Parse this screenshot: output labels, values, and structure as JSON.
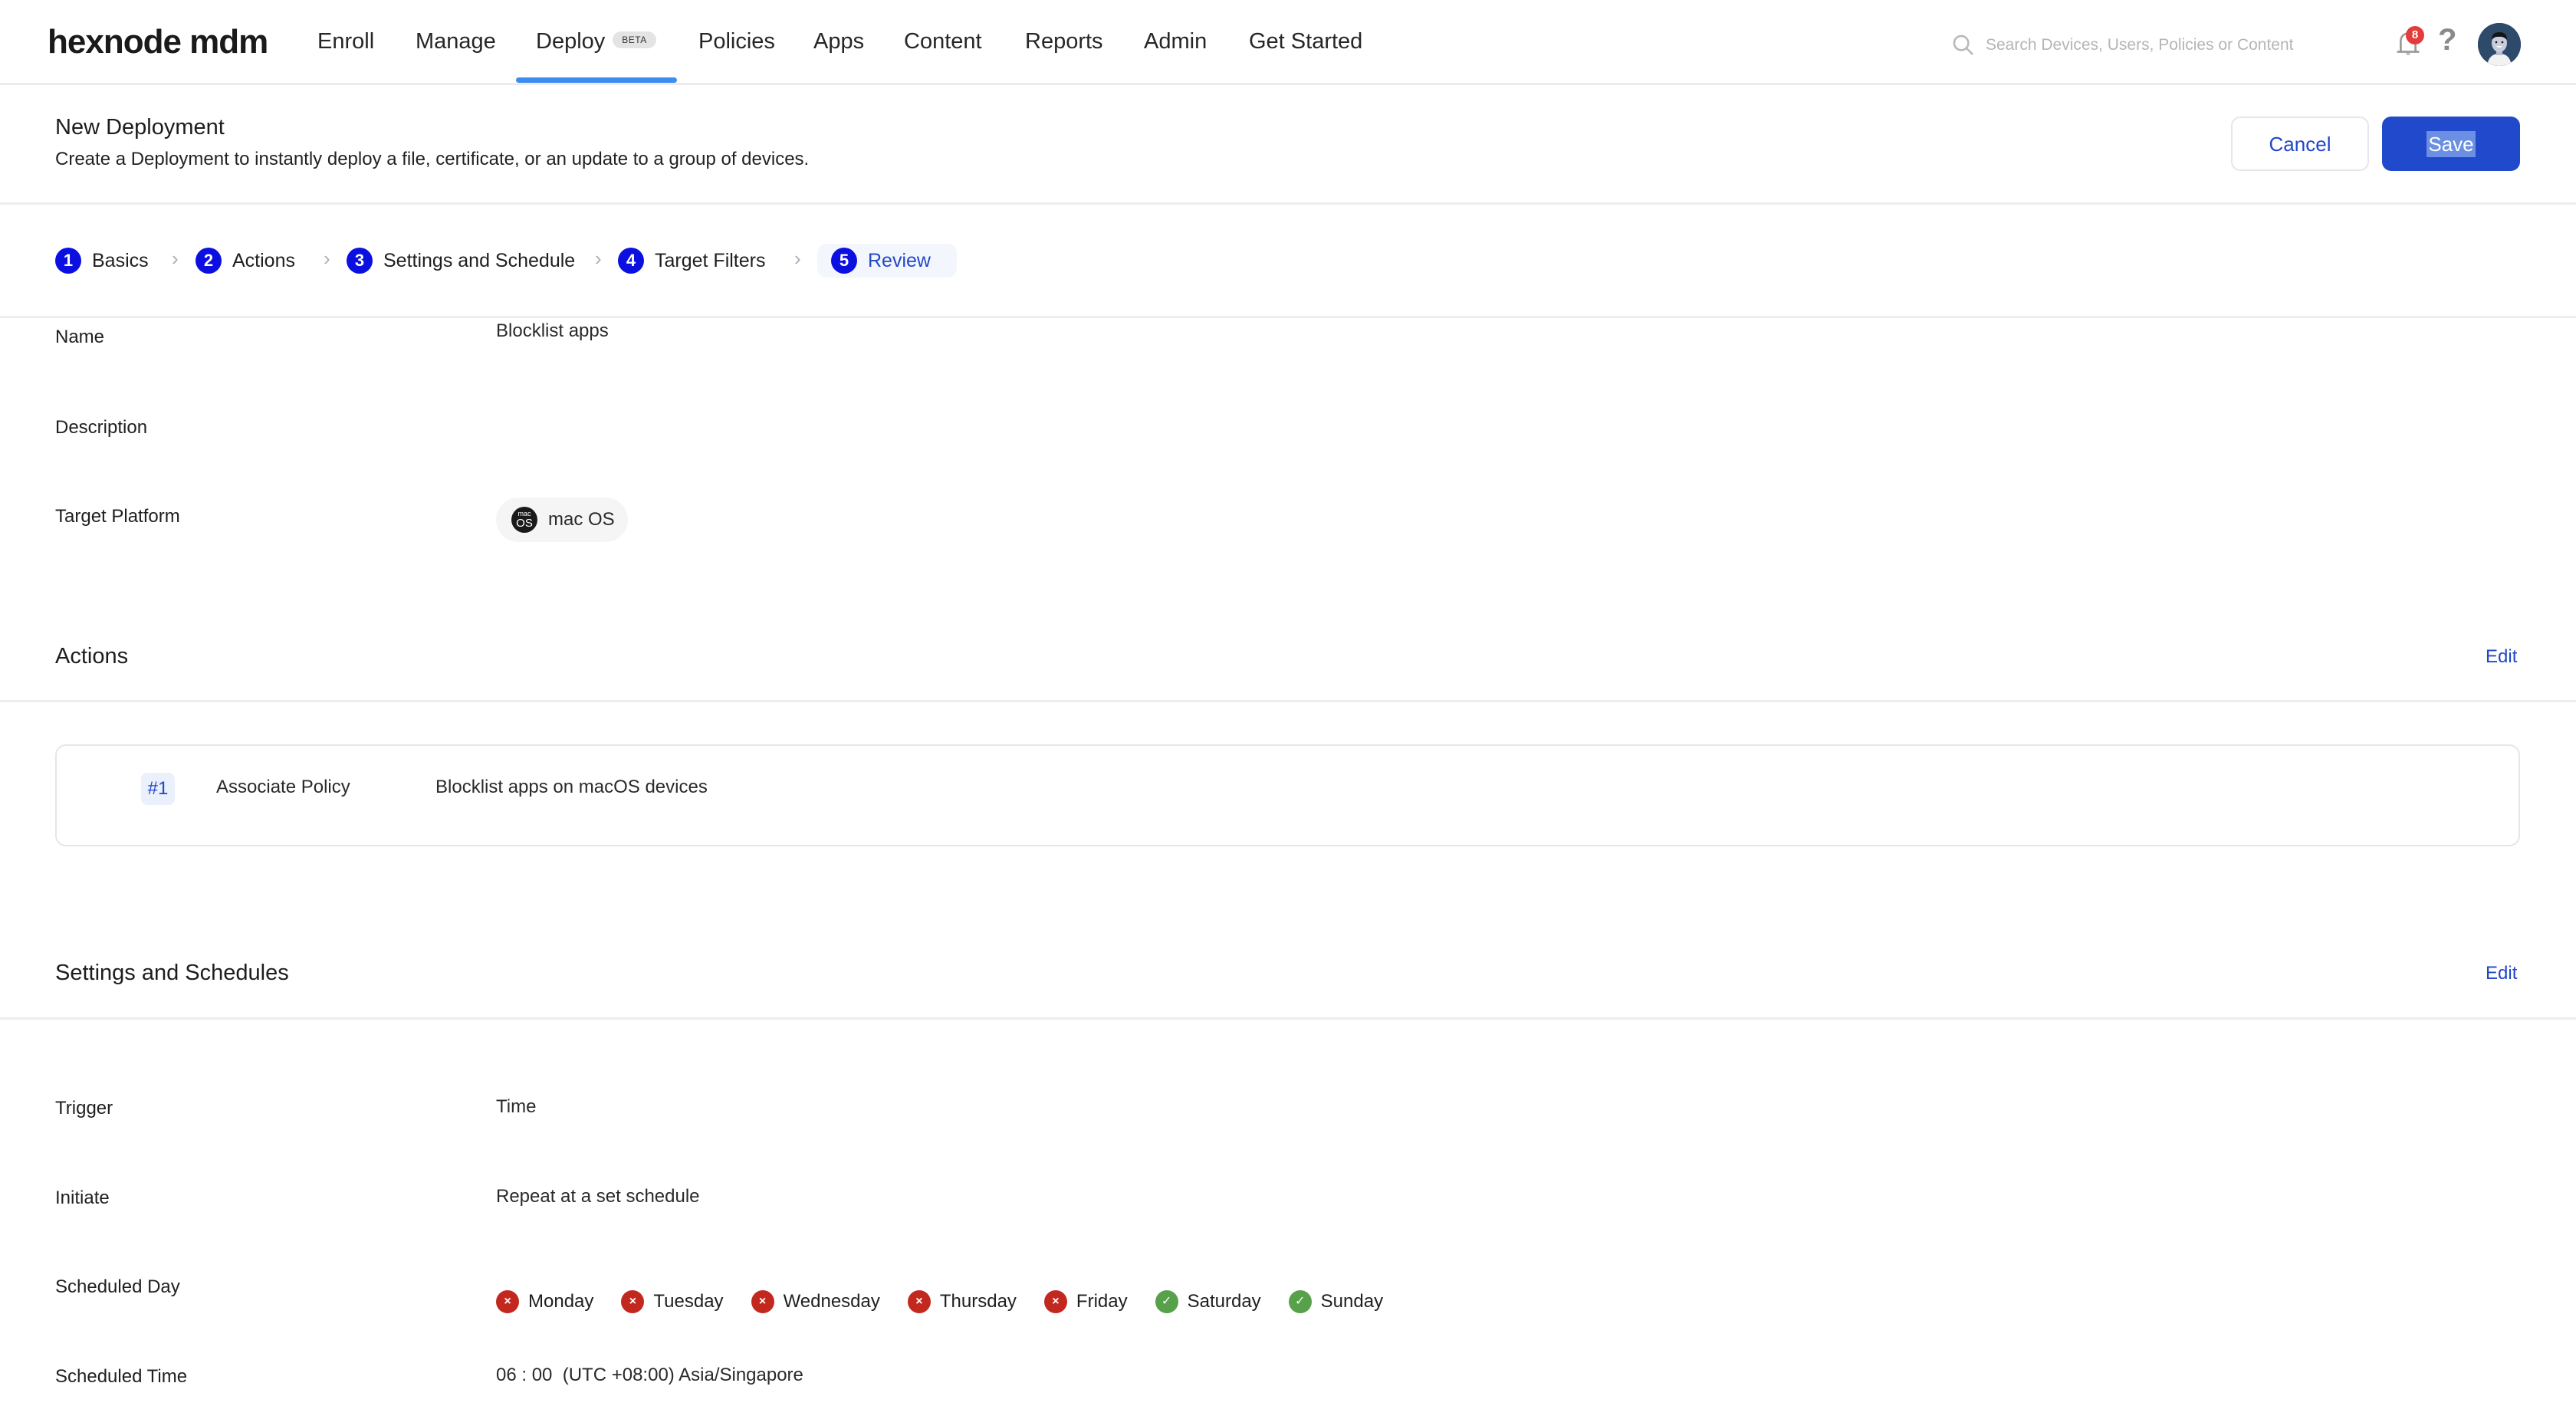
{
  "app": {
    "logo": "hexnode mdm"
  },
  "nav": {
    "items": [
      {
        "label": "Enroll"
      },
      {
        "label": "Manage"
      },
      {
        "label": "Deploy",
        "badge": "BETA",
        "active": true
      },
      {
        "label": "Policies"
      },
      {
        "label": "Apps"
      },
      {
        "label": "Content"
      },
      {
        "label": "Reports"
      },
      {
        "label": "Admin"
      },
      {
        "label": "Get Started"
      }
    ],
    "search_placeholder": "Search Devices, Users, Policies or Content",
    "notification_count": "8",
    "help_label": "?"
  },
  "page": {
    "title": "New Deployment",
    "subtitle": "Create a Deployment to instantly deploy a file, certificate, or an update to a group of devices.",
    "cancel_label": "Cancel",
    "save_label": "Save"
  },
  "stepper": {
    "steps": [
      {
        "num": "1",
        "label": "Basics"
      },
      {
        "num": "2",
        "label": "Actions"
      },
      {
        "num": "3",
        "label": "Settings and Schedule"
      },
      {
        "num": "4",
        "label": "Target Filters"
      },
      {
        "num": "5",
        "label": "Review",
        "active": true
      }
    ],
    "separator": "›"
  },
  "basics": {
    "name_label": "Name",
    "name_value": "Blocklist apps",
    "description_label": "Description",
    "description_value": "",
    "platform_label": "Target Platform",
    "platform_value": "mac OS",
    "platform_icon_top": "mac",
    "platform_icon_bottom": "OS"
  },
  "actions": {
    "title": "Actions",
    "edit_label": "Edit",
    "items": [
      {
        "num": "#1",
        "type": "Associate Policy",
        "description": "Blocklist apps on macOS devices"
      }
    ]
  },
  "settings": {
    "title": "Settings and Schedules",
    "edit_label": "Edit",
    "trigger_label": "Trigger",
    "trigger_value": "Time",
    "initiate_label": "Initiate",
    "initiate_value": "Repeat at a set schedule",
    "day_label": "Scheduled Day",
    "days": [
      {
        "name": "Monday",
        "enabled": false,
        "icon": "×"
      },
      {
        "name": "Tuesday",
        "enabled": false,
        "icon": "×"
      },
      {
        "name": "Wednesday",
        "enabled": false,
        "icon": "×"
      },
      {
        "name": "Thursday",
        "enabled": false,
        "icon": "×"
      },
      {
        "name": "Friday",
        "enabled": false,
        "icon": "×"
      },
      {
        "name": "Saturday",
        "enabled": true,
        "icon": "✓"
      },
      {
        "name": "Sunday",
        "enabled": true,
        "icon": "✓"
      }
    ],
    "time_label": "Scheduled Time",
    "time_value": "06 : 00  (UTC +08:00) Asia/Singapore"
  },
  "colors": {
    "primary": "#2149cb",
    "step_circle": "#0b10e0",
    "nav_active_underline": "#3f8cf0",
    "day_off": "#c3281f",
    "day_on": "#56a14a",
    "notification_badge": "#e23c3c"
  }
}
